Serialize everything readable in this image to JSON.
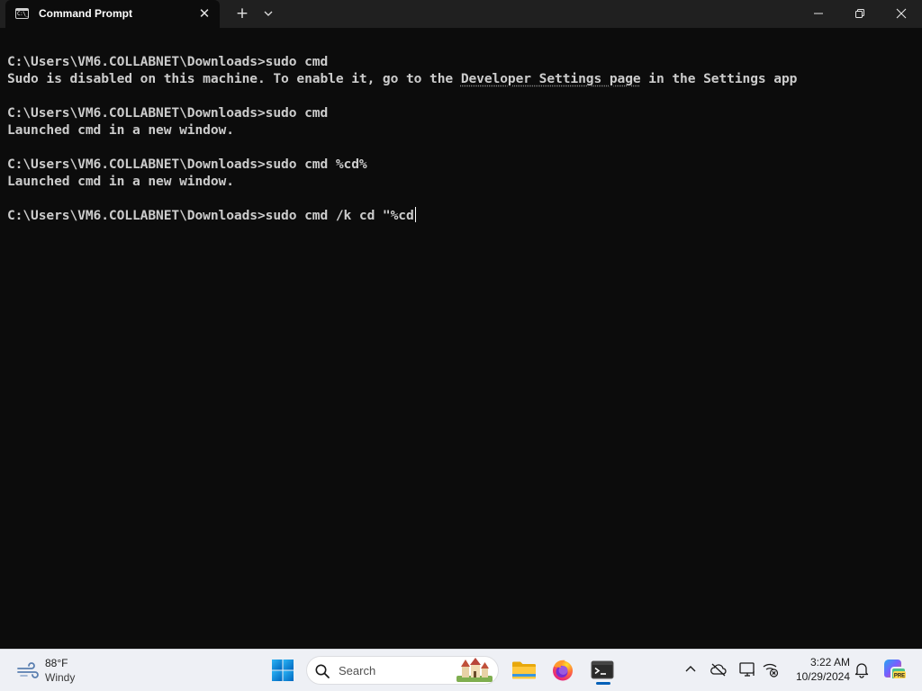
{
  "window": {
    "tab_title": "Command Prompt",
    "tab_icon_text": "C:\\_",
    "tab_close": "✕",
    "new_tab": "+",
    "dropdown_icon": "chevron-down-icon",
    "controls": [
      "minimize-icon",
      "restore-icon",
      "close-icon"
    ]
  },
  "terminal": {
    "lines": [
      "C:\\Users\\VM6.COLLABNET\\Downloads>sudo cmd",
      "Sudo is disabled on this machine. To enable it, go to the ",
      "Developer Settings page",
      " in the Settings app",
      "",
      "C:\\Users\\VM6.COLLABNET\\Downloads>sudo cmd",
      "Launched cmd in a new window.",
      "",
      "C:\\Users\\VM6.COLLABNET\\Downloads>sudo cmd %cd%",
      "Launched cmd in a new window.",
      "",
      "C:\\Users\\VM6.COLLABNET\\Downloads>sudo cmd /k cd \"%cd"
    ],
    "colors": {
      "background": "#0c0c0c",
      "foreground": "#cccccc"
    }
  },
  "taskbar": {
    "weather": {
      "temp": "88°F",
      "condition": "Windy",
      "icon": "wind-icon"
    },
    "search": {
      "label": "Search",
      "icon": "search-icon"
    },
    "apps": [
      "start-icon",
      "file-explorer-icon",
      "firefox-icon",
      "terminal-icon"
    ],
    "tray": [
      "chevron-up-icon",
      "onedrive-offline-icon",
      "display-icon",
      "network-disconnected-icon",
      "notification-bell-icon",
      "copilot-icon"
    ],
    "clock": {
      "time": "3:22 AM",
      "date": "10/29/2024"
    },
    "accent": "#005fb8"
  }
}
